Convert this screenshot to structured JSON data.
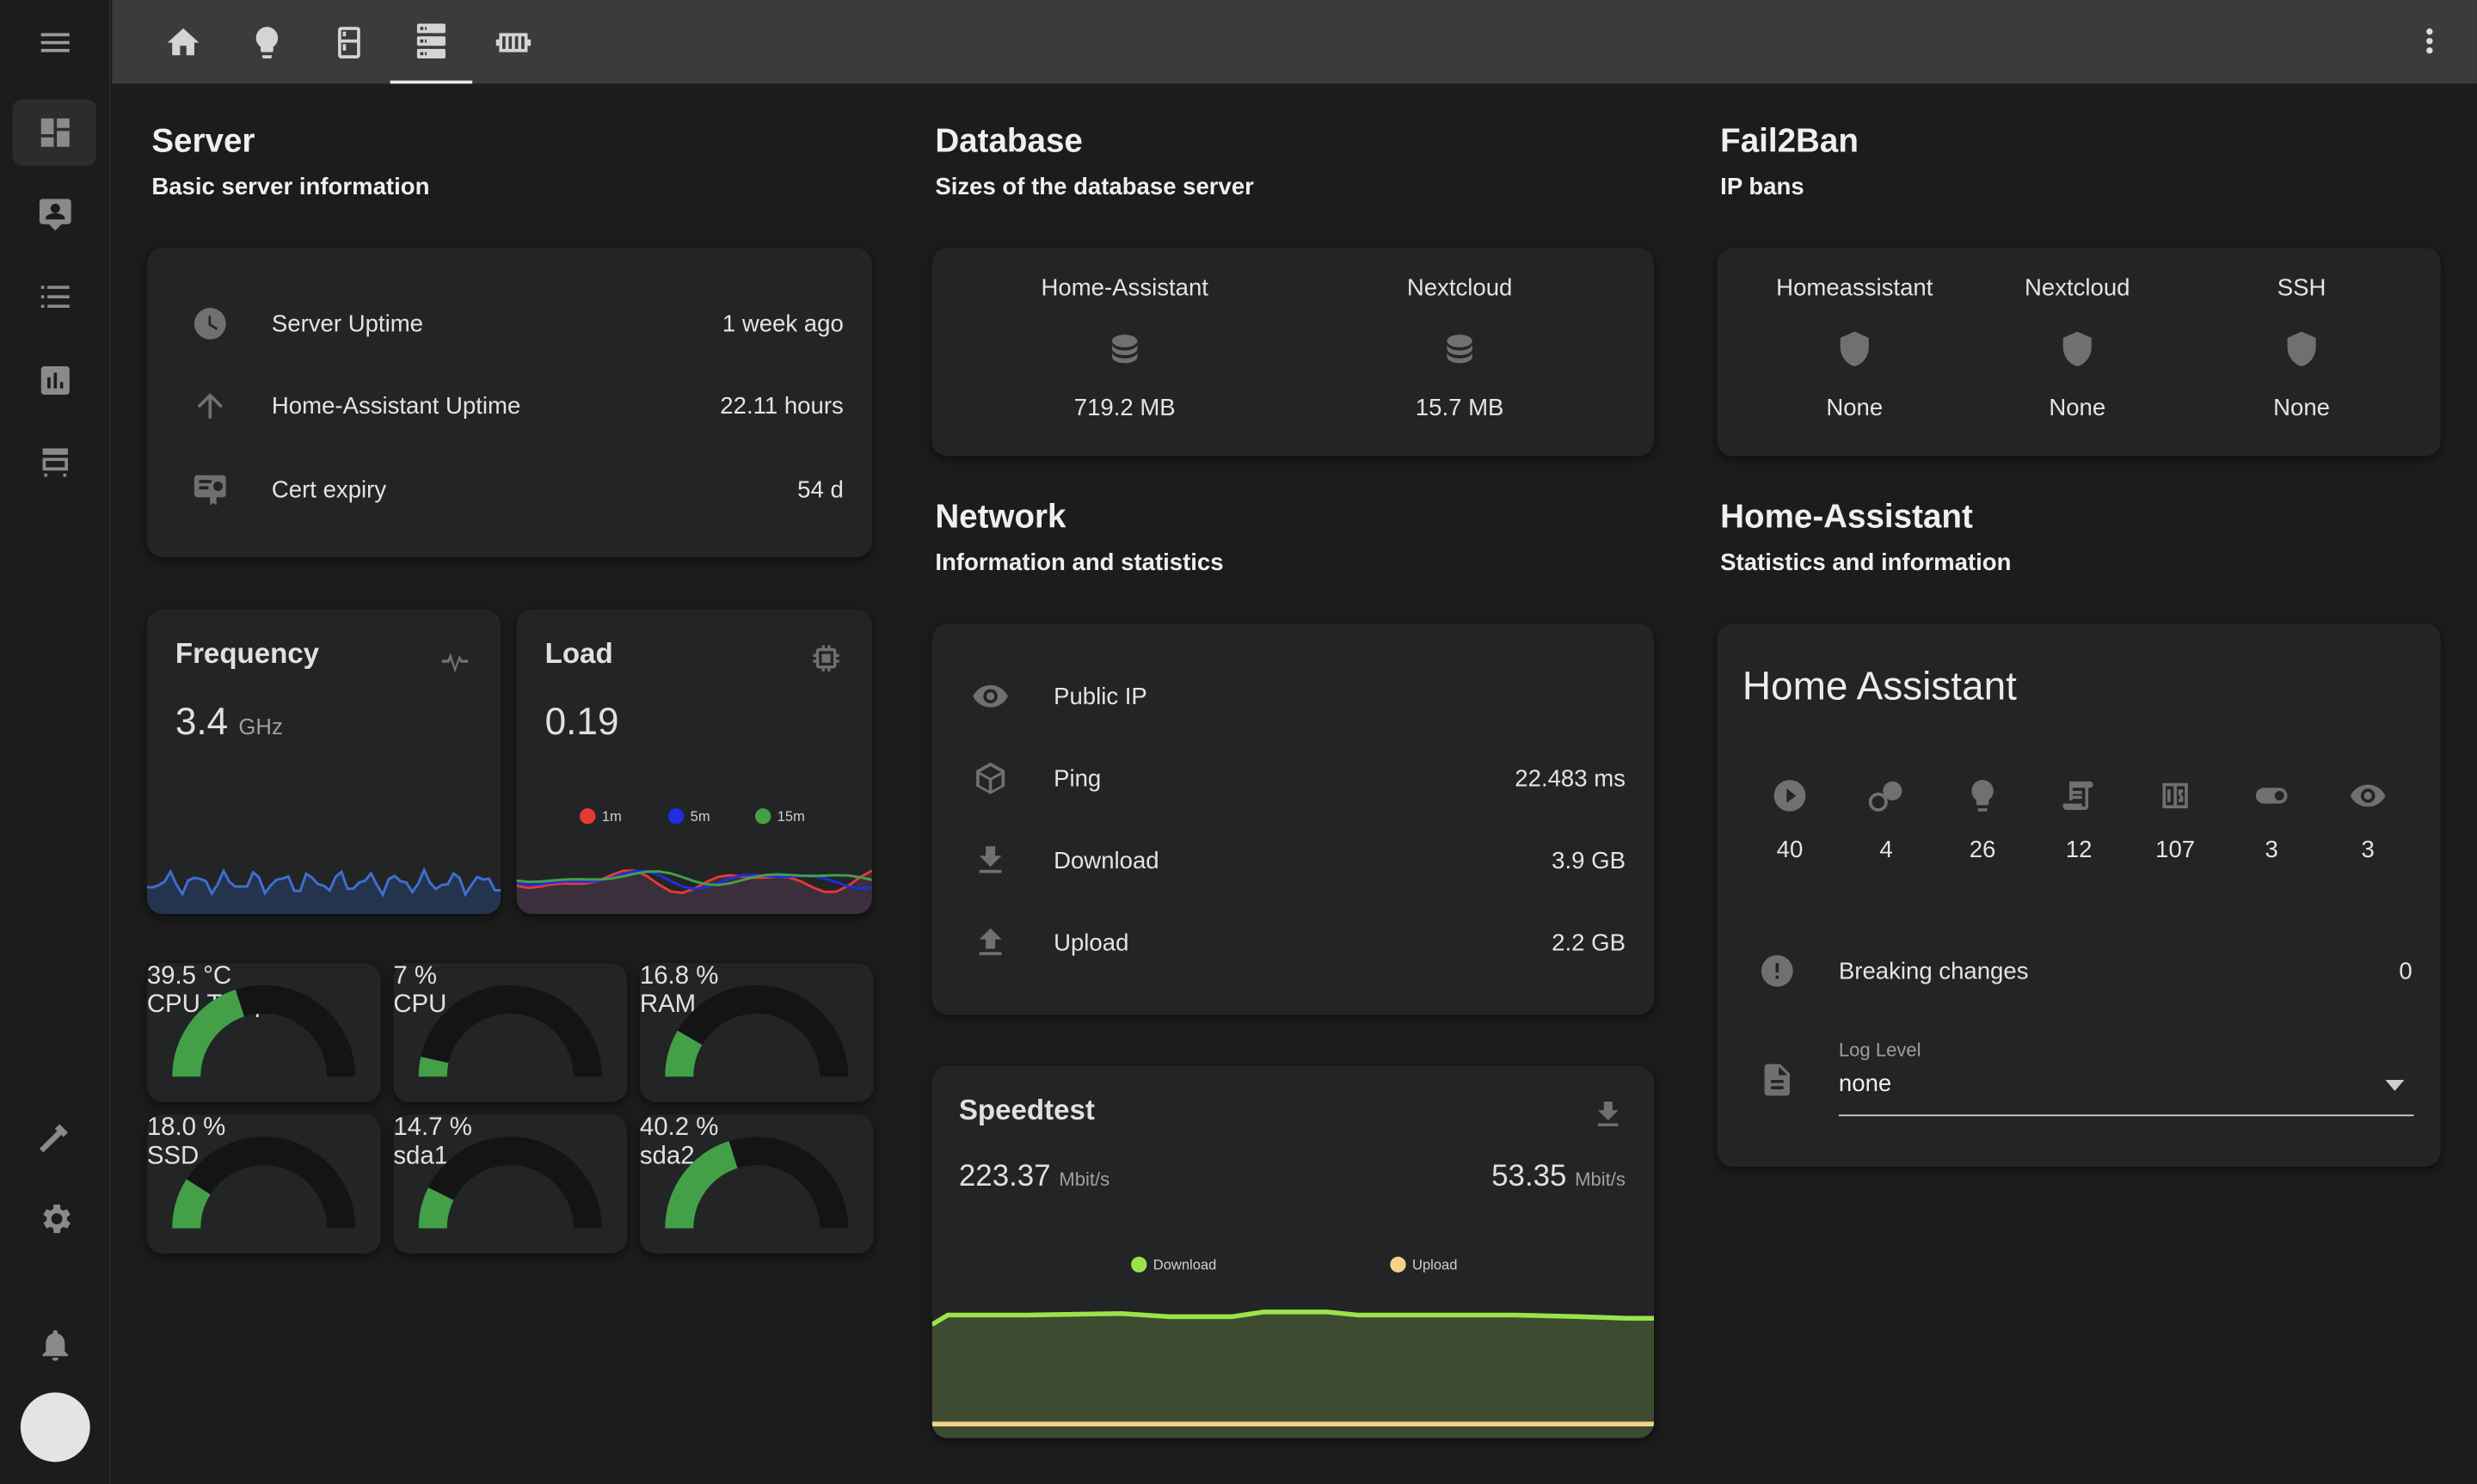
{
  "server": {
    "title": "Server",
    "subtitle": "Basic server information",
    "rows": [
      {
        "label": "Server Uptime",
        "value": "1 week ago"
      },
      {
        "label": "Home-Assistant Uptime",
        "value": "22.11 hours"
      },
      {
        "label": "Cert expiry",
        "value": "54 d"
      }
    ]
  },
  "frequency": {
    "title": "Frequency",
    "value": "3.4",
    "unit": "GHz"
  },
  "load": {
    "title": "Load",
    "value": "0.19",
    "legend": [
      "1m",
      "5m",
      "15m"
    ],
    "colors": [
      "#e53935",
      "#1e2ee0",
      "#43a047"
    ]
  },
  "gauges": [
    {
      "value": "39.5 °C",
      "label": "CPU Temp",
      "fraction": 0.4
    },
    {
      "value": "7 %",
      "label": "CPU",
      "fraction": 0.07
    },
    {
      "value": "16.8 %",
      "label": "RAM",
      "fraction": 0.168
    },
    {
      "value": "18.0 %",
      "label": "SSD",
      "fraction": 0.18
    },
    {
      "value": "14.7 %",
      "label": "sda1",
      "fraction": 0.147
    },
    {
      "value": "40.2 %",
      "label": "sda2",
      "fraction": 0.402
    }
  ],
  "database": {
    "title": "Database",
    "subtitle": "Sizes of the database server",
    "items": [
      {
        "name": "Home-Assistant",
        "value": "719.2 MB"
      },
      {
        "name": "Nextcloud",
        "value": "15.7 MB"
      }
    ]
  },
  "network": {
    "title": "Network",
    "subtitle": "Information and statistics",
    "rows": [
      {
        "label": "Public IP",
        "value": ""
      },
      {
        "label": "Ping",
        "value": "22.483 ms"
      },
      {
        "label": "Download",
        "value": "3.9 GB"
      },
      {
        "label": "Upload",
        "value": "2.2 GB"
      }
    ]
  },
  "speedtest": {
    "title": "Speedtest",
    "download": "223.37",
    "upload": "53.35",
    "unit": "Mbit/s",
    "legend": [
      "Download",
      "Upload"
    ],
    "colors": [
      "#9be34a",
      "#f5d28a"
    ]
  },
  "fail2ban": {
    "title": "Fail2Ban",
    "subtitle": "IP bans",
    "items": [
      {
        "name": "Homeassistant",
        "value": "None"
      },
      {
        "name": "Nextcloud",
        "value": "None"
      },
      {
        "name": "SSH",
        "value": "None"
      }
    ]
  },
  "homeassistant": {
    "title": "Home-Assistant",
    "subtitle": "Statistics and information",
    "card_title": "Home Assistant",
    "stats": [
      {
        "icon": "play-icon",
        "value": "40"
      },
      {
        "icon": "group-icon",
        "value": "4"
      },
      {
        "icon": "bulb-icon",
        "value": "26"
      },
      {
        "icon": "script-icon",
        "value": "12"
      },
      {
        "icon": "counter-icon",
        "value": "107"
      },
      {
        "icon": "toggle-icon",
        "value": "3"
      },
      {
        "icon": "eye-icon",
        "value": "3"
      }
    ],
    "breaking_label": "Breaking changes",
    "breaking_value": "0",
    "log_label": "Log Level",
    "log_value": "none"
  },
  "accent": "#43a047"
}
